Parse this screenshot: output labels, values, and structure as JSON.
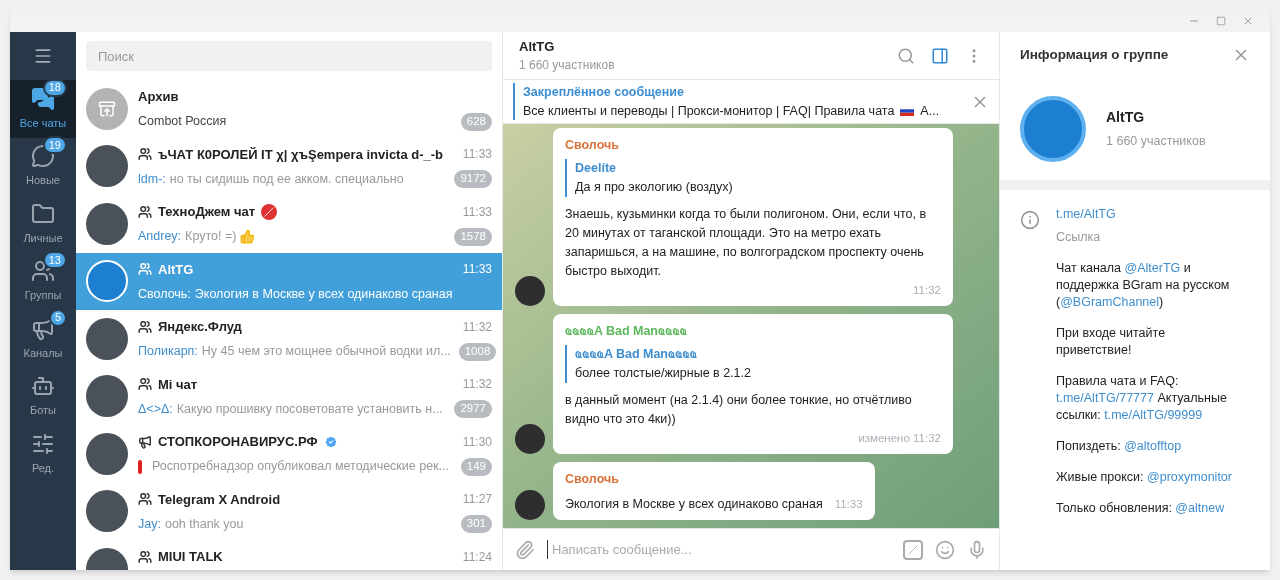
{
  "folders": [
    {
      "kind": "all",
      "label": "Все чаты",
      "badge": "18",
      "selected": true
    },
    {
      "kind": "new",
      "label": "Новые",
      "badge": "19",
      "selected": false
    },
    {
      "kind": "personal",
      "label": "Личные",
      "selected": false
    },
    {
      "kind": "groups",
      "label": "Группы",
      "badge": "13",
      "selected": false
    },
    {
      "kind": "channels",
      "label": "Каналы",
      "badge": "5",
      "selected": false
    },
    {
      "kind": "bots",
      "label": "Боты",
      "selected": false
    },
    {
      "kind": "edit",
      "label": "Ред.",
      "selected": false
    }
  ],
  "search": {
    "placeholder": "Поиск"
  },
  "chats": [
    {
      "kind": "archive",
      "name": "Архив",
      "text": "Combot Россия",
      "count": "628",
      "selected": false
    },
    {
      "kind": "group",
      "name": "ъЧАТ К0РОЛЕЙ IT χ| χъŞempera invicta d-_-b",
      "time": "11:33",
      "sender": "ldm-:",
      "text": "но ты сидишь под ее акком. специально",
      "count": "9172",
      "selected": false
    },
    {
      "kind": "group",
      "name": "ТехноДжем чат",
      "adult_mark": true,
      "time": "11:33",
      "sender": "Andrey:",
      "text": "Круто! =)",
      "thumbs_up": true,
      "count": "1578",
      "selected": false
    },
    {
      "kind": "group",
      "name": "AltTG",
      "time": "11:33",
      "sender": "Сволочь:",
      "text": "Экология в Москве у всех одинаково сраная",
      "selected": true
    },
    {
      "kind": "group",
      "name": "Яндекс.Флуд",
      "time": "11:32",
      "sender": "Поликарп:",
      "text": "Ну 45 чем это мощнее обычной водки ил...",
      "count": "1008",
      "selected": false
    },
    {
      "kind": "group",
      "name": "Mi чат",
      "time": "11:32",
      "sender": "Δ<>Δ:",
      "text": "Какую прошивку посоветовате установить н...",
      "count": "2977",
      "selected": false
    },
    {
      "kind": "channel",
      "name": "СТОПКОРОНАВИРУС.РФ",
      "verified": true,
      "alert": true,
      "time": "11:30",
      "text": "Роспотребнадзор опубликовал методические рек...",
      "count": "149",
      "selected": false
    },
    {
      "kind": "group",
      "name": "Telegram X Android",
      "time": "11:27",
      "sender": "Jay:",
      "text": "ooh thank you",
      "count": "301",
      "selected": false
    },
    {
      "kind": "group",
      "name": "MIUI TALK",
      "time": "11:24",
      "selected": false
    }
  ],
  "chat": {
    "title": "AltTG",
    "subtitle": "1 660 участников",
    "info_open": true,
    "pinned": {
      "label": "Закреплённое сообщение",
      "text": "Все клиенты и переводы | Прокси-монитор | FAQ| Правила чата",
      "tail": "А..."
    },
    "messages": [
      {
        "author": "Сволочь",
        "color": "#d9733b",
        "reply": {
          "author": "Deelíte",
          "text": "Да я про экологию (воздух)"
        },
        "text": "Знаешь, кузьминки когда то были полигоном. Они, если что, в 20 минутах от таганской площади. Это на метро ехать запаришься, а на машине, по волгоградском проспекту очень быстро выходит.",
        "time": "11:32"
      },
      {
        "author": "ҩҩҩҩA Bad Manҩҩҩҩ",
        "color": "#5cb85c",
        "reply": {
          "author": "ҩҩҩҩA Bad Manҩҩҩҩ",
          "text": "более толстые/жирные в 2.1.2"
        },
        "text": "в данный момент (на 2.1.4) они более тонкие, но отчётливо видно что это 4ки))",
        "time": "изменено 11:32"
      },
      {
        "author": "Сволочь",
        "color": "#d9733b",
        "text": "Экология в Москве у всех одинаково сраная",
        "time": "11:33"
      }
    ],
    "input": {
      "placeholder": "Написать сообщение..."
    }
  },
  "info": {
    "title": "Информация о группе",
    "name": "AltTG",
    "subtitle": "1 660 участников",
    "link": "t.me/AltTG",
    "link_label": "Ссылка",
    "about": [
      [
        {
          "t": "Чат канала "
        },
        {
          "t": "@AlterTG",
          "link": true
        },
        {
          "t": " и поддержка BGram на русском ("
        },
        {
          "t": "@BGramChannel",
          "link": true
        },
        {
          "t": ")"
        }
      ],
      [
        {
          "t": "При входе читайте приветствие!"
        }
      ],
      [
        {
          "t": "Правила чата и FAQ: "
        },
        {
          "t": "t.me/AltTG/77777",
          "link": true
        },
        {
          "t": " Актуальные ссылки: "
        },
        {
          "t": "t.me/AltTG/99999",
          "link": true
        }
      ],
      [
        {
          "t": "Попиздеть: "
        },
        {
          "t": "@altofftop",
          "link": true
        }
      ],
      [
        {
          "t": "Живые прокси: "
        },
        {
          "t": "@proxymonitor",
          "link": true
        }
      ],
      [
        {
          "t": "Только обновления: "
        },
        {
          "t": "@altnew",
          "link": true
        }
      ]
    ]
  }
}
